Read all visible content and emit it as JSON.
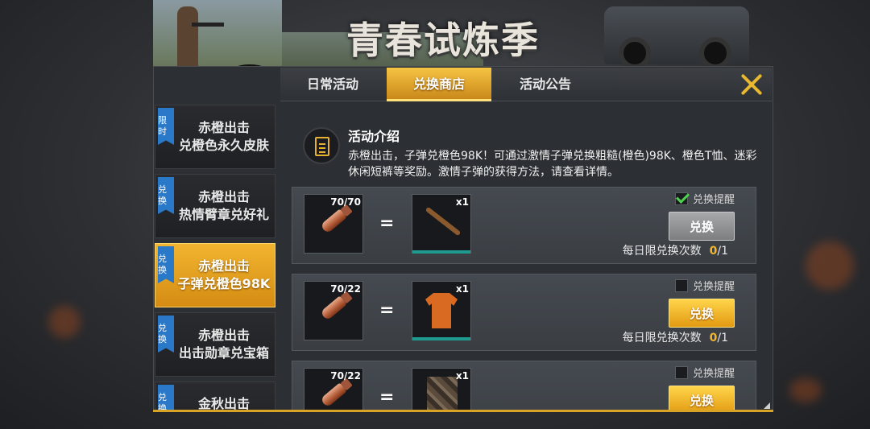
{
  "banner": {
    "title": "青春试炼季"
  },
  "tabs": [
    {
      "label": "日常活动",
      "active": false
    },
    {
      "label": "兑换商店",
      "active": true
    },
    {
      "label": "活动公告",
      "active": false
    }
  ],
  "sidebar": {
    "items": [
      {
        "badge": "限时",
        "line1": "赤橙出击",
        "line2": "兑橙色永久皮肤",
        "active": false
      },
      {
        "badge": "兑换",
        "line1": "赤橙出击",
        "line2": "热情臂章兑好礼",
        "active": false
      },
      {
        "badge": "兑换",
        "line1": "赤橙出击",
        "line2": "子弹兑橙色98K",
        "active": true
      },
      {
        "badge": "兑换",
        "line1": "赤橙出击",
        "line2": "出击勋章兑宝箱",
        "active": false
      },
      {
        "badge": "兑换",
        "line1": "金秋出击",
        "line2": "",
        "active": false
      }
    ]
  },
  "intro": {
    "title": "活动介绍",
    "body": "赤橙出击，子弹兑橙色98K！可通过激情子弹兑换粗糙(橙色)98K、橙色T恤、迷彩休闲短裤等奖励。激情子弹的获得方法，请查看详情。"
  },
  "rows": [
    {
      "cost_count": "70/70",
      "equals": "=",
      "reward_count": "x1",
      "reward_icon": "rifle-98k-icon",
      "remind_label": "兑换提醒",
      "remind_checked": true,
      "button_label": "兑换",
      "button_state": "disabled",
      "limit_label": "每日限兑换次数",
      "limit_used": "0",
      "limit_total": "/1"
    },
    {
      "cost_count": "70/22",
      "equals": "=",
      "reward_count": "x1",
      "reward_icon": "orange-tshirt-icon",
      "remind_label": "兑换提醒",
      "remind_checked": false,
      "button_label": "兑换",
      "button_state": "enabled",
      "limit_label": "每日限兑换次数",
      "limit_used": "0",
      "limit_total": "/1"
    },
    {
      "cost_count": "70/22",
      "equals": "=",
      "reward_count": "x1",
      "reward_icon": "camo-shorts-icon",
      "remind_label": "兑换提醒",
      "remind_checked": false,
      "button_label": "兑换",
      "button_state": "enabled"
    }
  ],
  "colors": {
    "accent": "#f2b530",
    "tab_active": "#e6a52a",
    "badge_blue": "#2a78c8",
    "reward_bar": "#1f9a8e"
  }
}
